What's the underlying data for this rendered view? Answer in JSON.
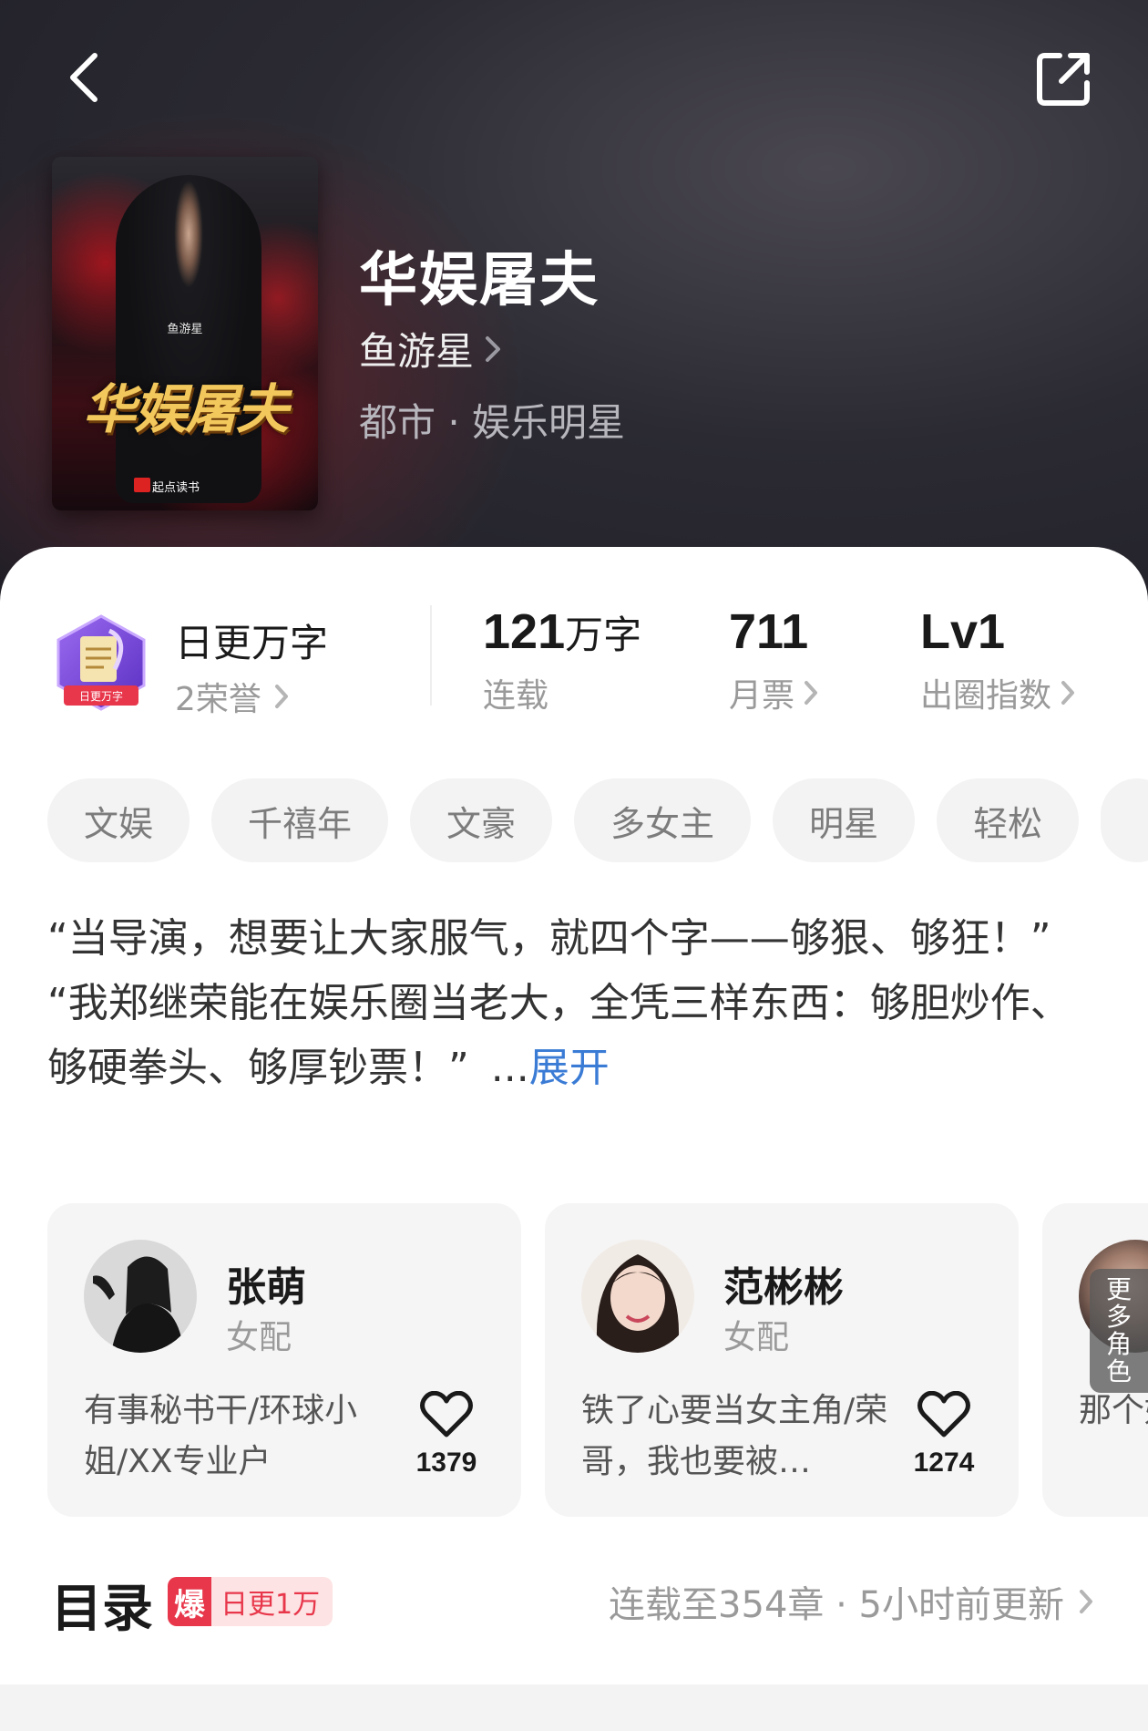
{
  "header": {
    "book_title": "华娱屠夫",
    "author": "鱼游星",
    "genre": "都市 · 娱乐明星",
    "cover": {
      "title": "华娱屠夫",
      "author": "鱼游星",
      "publisher": "起点读书"
    }
  },
  "honor": {
    "badge_text": "日更万字",
    "title": "日更万字",
    "count": "2荣誉"
  },
  "stats": [
    {
      "value": "121",
      "unit": "万字",
      "label": "连载"
    },
    {
      "value": "711",
      "unit": "",
      "label": "月票"
    },
    {
      "value": "Lv1",
      "unit": "",
      "label": "出圈指数"
    }
  ],
  "tags": [
    "文娱",
    "千禧年",
    "文豪",
    "多女主",
    "明星",
    "轻松"
  ],
  "intro": {
    "line1": "“当导演，想要让大家服气，就四个字——够狠、够狂！”",
    "line2": "“我郑继荣能在娱乐圈当老大，全凭三样东西：够胆炒作、够硬拳头、够厚钞票！”",
    "ellipsis": "...",
    "expand_label": "展开"
  },
  "characters": [
    {
      "name": "张萌",
      "role": "女配",
      "desc": "有事秘书干/环球小姐/XX专业户",
      "likes": "1379"
    },
    {
      "name": "范彬彬",
      "role": "女配",
      "desc": "铁了心要当女主角/荣哥，我也要被…",
      "likes": "1274"
    }
  ],
  "more_characters": {
    "label": "更多角色",
    "snippet": "那个好/荣"
  },
  "toc": {
    "title": "目录",
    "badge_icon": "爆",
    "badge_text": "日更1万",
    "status": "连载至354章 · 5小时前更新"
  },
  "colors": {
    "accent_link": "#3a7bd5",
    "badge_red": "#e8374b",
    "header_bg": "#2b2a32"
  }
}
